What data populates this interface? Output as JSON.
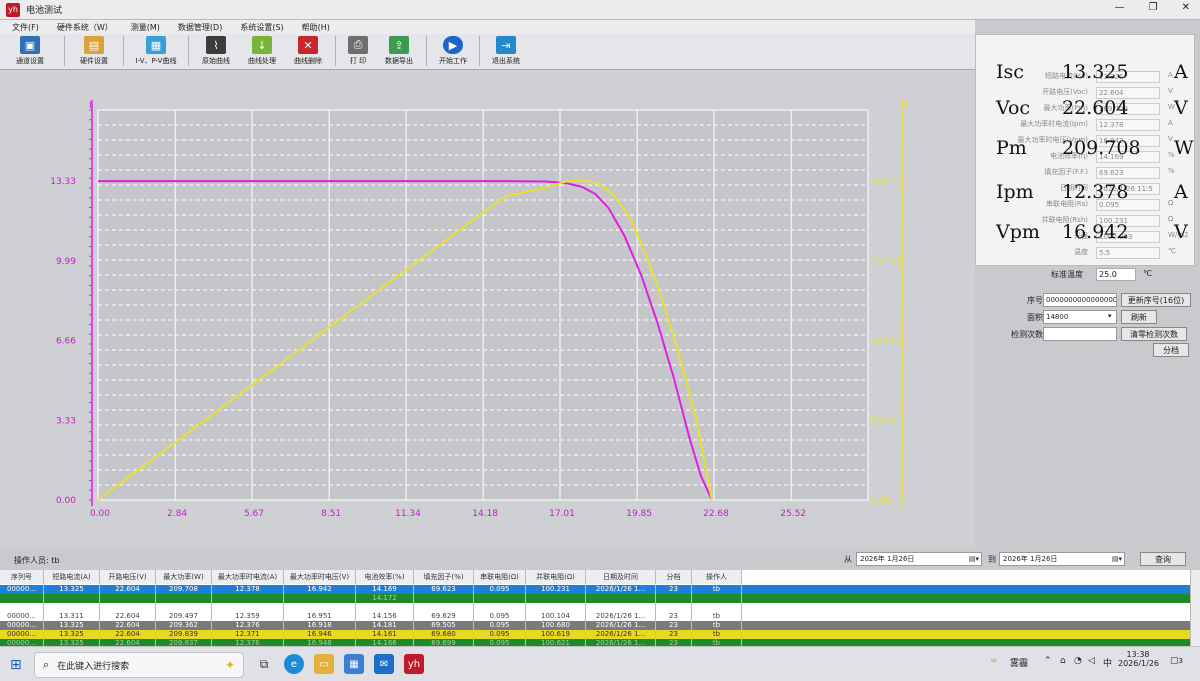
{
  "window": {
    "title": "电池测试",
    "minimize": "—",
    "maximize": "❐",
    "close": "✕"
  },
  "menu": [
    "文件(F)",
    "硬件系统（W）",
    "测量(M)",
    "数据管理(D)",
    "系统设置(S)",
    "帮助(H)"
  ],
  "toolbar": [
    {
      "label": "通道设置",
      "icon": "monitor-icon",
      "color": "#2f6fb4"
    },
    {
      "label": "硬件设置",
      "icon": "hardware-icon",
      "color": "#d9a23b"
    },
    {
      "label": "I-V、P-V曲线",
      "icon": "iv-curve-icon",
      "color": "#3a9fd9"
    },
    {
      "label": "原始曲线",
      "icon": "raw-curve-icon",
      "color": "#3b3b3b"
    },
    {
      "label": "曲线处理",
      "icon": "process-icon",
      "color": "#7ab33a"
    },
    {
      "label": "曲线删除",
      "icon": "delete-icon",
      "color": "#c8262b"
    },
    {
      "label": "打 印",
      "icon": "print-icon",
      "color": "#6d6d6d"
    },
    {
      "label": "数据导出",
      "icon": "export-icon",
      "color": "#3d9b4f"
    },
    {
      "label": "开始工作",
      "icon": "play-icon",
      "color": "#1e63c8"
    },
    {
      "label": "退出系统",
      "icon": "exit-icon",
      "color": "#2389c8"
    }
  ],
  "chart_data": {
    "type": "line",
    "x_ticks": [
      "0.00",
      "2.84",
      "5.67",
      "8.51",
      "11.34",
      "14.18",
      "17.01",
      "19.85",
      "22.68",
      "25.52"
    ],
    "left_ticks": [
      "13.33",
      "9.99",
      "6.66",
      "3.33",
      "0.00"
    ],
    "right_ticks": [
      "209.71",
      "157.28",
      "104.85",
      "52.43",
      "0.00"
    ],
    "left_axis_label": "I",
    "right_axis_label": "P",
    "xlim": [
      0,
      28.35
    ],
    "ylim_left": [
      0,
      16.3
    ],
    "ylim_right": [
      0,
      256
    ],
    "series": [
      {
        "name": "I-V",
        "axis": "left",
        "color": "#e020e0",
        "x": [
          0,
          15,
          16.5,
          17.2,
          17.8,
          18.3,
          18.8,
          19.4,
          20.0,
          20.6,
          21.2,
          21.8,
          22.2,
          22.604
        ],
        "y": [
          13.33,
          13.33,
          13.31,
          13.25,
          13.1,
          12.8,
          12.2,
          11.0,
          9.4,
          7.4,
          5.1,
          2.5,
          1.0,
          0
        ]
      },
      {
        "name": "P-V",
        "axis": "right",
        "color": "#e8e030",
        "x": [
          0,
          4,
          8,
          12,
          15,
          16.5,
          17.2,
          17.6,
          18.0,
          18.5,
          19.0,
          19.6,
          20.2,
          20.8,
          21.4,
          22.0,
          22.604
        ],
        "y": [
          0,
          53.3,
          106.6,
          160,
          199.5,
          205,
          209,
          209.7,
          209.5,
          207,
          200,
          185,
          160,
          130,
          95,
          55,
          0
        ]
      }
    ]
  },
  "readout_small": [
    {
      "label": "短路电流(Isc)",
      "value": "13.325",
      "unit": "A"
    },
    {
      "label": "开路电压(Voc)",
      "value": "22.604",
      "unit": "V"
    },
    {
      "label": "最大功率(Pm)",
      "value": "209.708",
      "unit": "W"
    },
    {
      "label": "最大功率时电流(Ipm)",
      "value": "12.378",
      "unit": "A"
    },
    {
      "label": "最大功率时电压(Vpm)",
      "value": "16.942",
      "unit": "V"
    },
    {
      "label": "电池效率(η)",
      "value": "14.169",
      "unit": "%"
    },
    {
      "label": "填充因子(F.F.)",
      "value": "69.623",
      "unit": "%"
    },
    {
      "label": "日期时间",
      "value": "2026/1/26 11:5",
      "unit": ""
    },
    {
      "label": "串联电阻(Rs)",
      "value": "0.095",
      "unit": "Ω"
    },
    {
      "label": "并联电阻(Rsh)",
      "value": "100.231",
      "unit": "Ω"
    },
    {
      "label": "光强",
      "value": "1000.063",
      "unit": "W/m2"
    },
    {
      "label": "温度",
      "value": "5.5",
      "unit": "℃"
    }
  ],
  "readout_big": [
    {
      "label": "Isc",
      "value": "13.325",
      "unit": "A"
    },
    {
      "label": "Voc",
      "value": "22.604",
      "unit": "V"
    },
    {
      "label": "Pm",
      "value": "209.708",
      "unit": "W"
    },
    {
      "label": "Ipm",
      "value": "12.378",
      "unit": "A"
    },
    {
      "label": "Vpm",
      "value": "16.942",
      "unit": "V"
    }
  ],
  "std_temp": {
    "label": "标准温度",
    "value": "25.0",
    "unit": "℃"
  },
  "form": {
    "serial_label": "序号",
    "serial_value": "0000000000000000",
    "serial_button": "更新序号(16位)",
    "area_label": "面积",
    "area_value": "14800",
    "refresh_button": "刷新",
    "count_label": "检测次数",
    "count_value": "",
    "clear_button": "清零检测次数",
    "bin_button": "分档"
  },
  "operator": {
    "label": "操作人员:",
    "value": "tb"
  },
  "query": {
    "from_label": "从",
    "from_date": "2026年 1月26日",
    "to_label": "到",
    "to_date": "2026年 1月26日",
    "button": "查询"
  },
  "table": {
    "headers": [
      "序列号",
      "短路电流(A)",
      "开路电压(V)",
      "最大功率(W)",
      "最大功率时电流(A)",
      "最大功率时电压(V)",
      "电池效率(%)",
      "填充因子(%)",
      "串联电阻(Ω)",
      "并联电阻(Ω)",
      "日期及时间",
      "分档",
      "操作人"
    ],
    "rows": [
      {
        "bg": "#1f7fd8",
        "fg": "#ffffff",
        "cells": [
          "00000...",
          "13.325",
          "22.604",
          "209.708",
          "12.378",
          "16.942",
          "14.169",
          "69.623",
          "0.095",
          "100.231",
          "2026/1/26 1...",
          "23",
          "tb"
        ]
      },
      {
        "bg": "#1f8a2a",
        "fg": "#9fd39f",
        "cells": [
          "",
          "",
          "",
          "",
          "",
          "",
          "14.172",
          "",
          "",
          "",
          "",
          "",
          ""
        ]
      },
      {
        "bg": "#ffffff",
        "fg": "#444444",
        "cells": [
          "",
          "",
          "",
          "",
          "",
          "",
          "",
          "",
          "",
          "",
          "",
          "",
          ""
        ]
      },
      {
        "bg": "#ffffff",
        "fg": "#444444",
        "cells": [
          "00000...",
          "13.311",
          "22.604",
          "209.497",
          "12.359",
          "16.951",
          "14.156",
          "69.629",
          "0.095",
          "100.104",
          "2026/1/26 1...",
          "23",
          "tb"
        ]
      },
      {
        "bg": "#7a7a7a",
        "fg": "#ffffff",
        "cells": [
          "00000...",
          "13.325",
          "22.604",
          "209.362",
          "12.376",
          "16.918",
          "14.181",
          "69.505",
          "0.095",
          "100.680",
          "2026/1/26 1...",
          "23",
          "tb"
        ]
      },
      {
        "bg": "#e8d820",
        "fg": "#333333",
        "cells": [
          "00000...",
          "13.325",
          "22.604",
          "209.839",
          "12.371",
          "16.946",
          "14.161",
          "69.680",
          "0.095",
          "100.619",
          "2026/1/26 1...",
          "23",
          "tb"
        ]
      },
      {
        "bg": "#1f8a2a",
        "fg": "#9fd39f",
        "cells": [
          "00000...",
          "13.325",
          "22.604",
          "209.837",
          "12.376",
          "16.948",
          "14.166",
          "69.699",
          "0.095",
          "100.621",
          "2026/1/26 1...",
          "23",
          "tb"
        ]
      }
    ]
  },
  "taskbar": {
    "search_placeholder": "在此键入进行搜索",
    "weather": "雾霾",
    "ime": "中",
    "time": "13:38",
    "date": "2026/1/26",
    "notifications": "3"
  }
}
